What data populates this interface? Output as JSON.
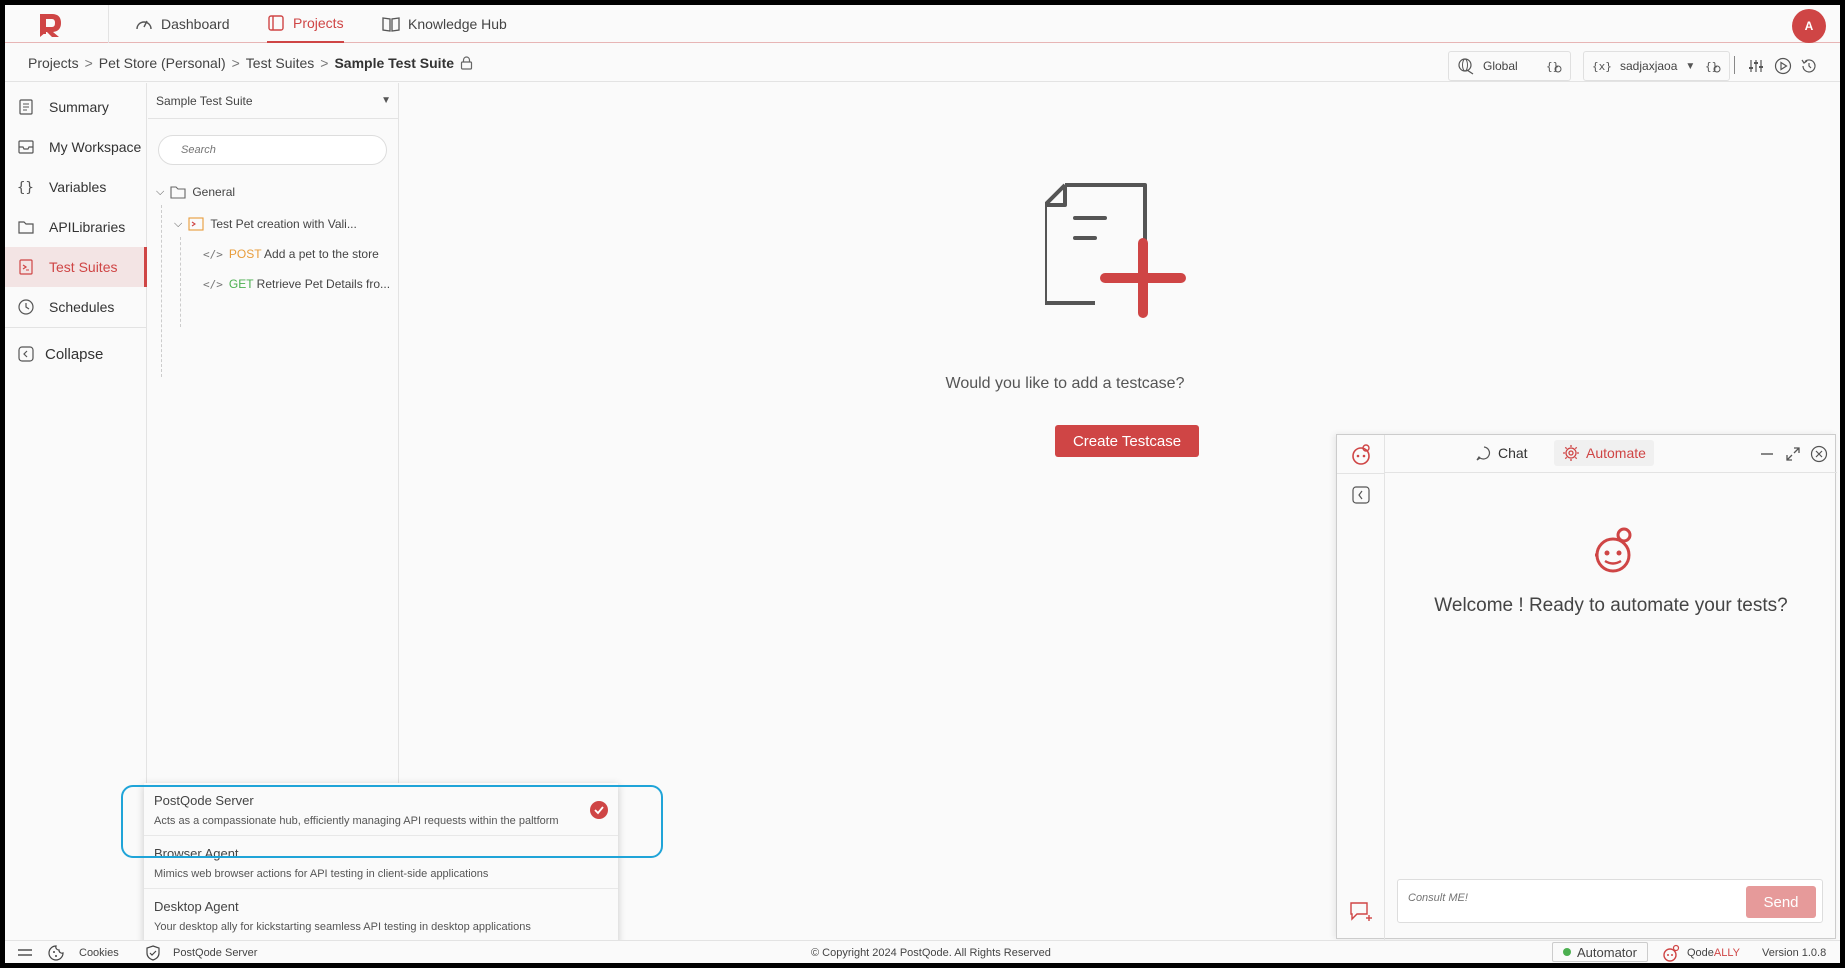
{
  "nav": {
    "items": [
      {
        "label": "Dashboard",
        "icon": "gauge-icon"
      },
      {
        "label": "Projects",
        "icon": "folder-icon"
      },
      {
        "label": "Knowledge Hub",
        "icon": "book-icon"
      }
    ],
    "avatar_initial": "A"
  },
  "breadcrumb": {
    "items": [
      "Projects",
      "Pet Store (Personal)",
      "Test Suites"
    ],
    "current": "Sample Test Suite",
    "separator": ">"
  },
  "env": {
    "global_label": "Global",
    "user_label": "sadjaxjaoa"
  },
  "sidebar": {
    "items": [
      {
        "label": "Summary",
        "icon": "summary-icon"
      },
      {
        "label": "My Workspace",
        "icon": "inbox-icon"
      },
      {
        "label": "Variables",
        "icon": "braces-icon"
      },
      {
        "label": "APILibraries",
        "icon": "folder-icon"
      },
      {
        "label": "Test Suites",
        "icon": "test-suite-icon"
      },
      {
        "label": "Schedules",
        "icon": "clock-icon"
      }
    ],
    "collapse_label": "Collapse"
  },
  "tree": {
    "suite_name": "Sample Test Suite",
    "search_placeholder": "Search",
    "folder": "General",
    "testcase": "Test Pet creation with Vali...",
    "requests": [
      {
        "method": "POST",
        "name": "Add a pet to the store"
      },
      {
        "method": "GET",
        "name": "Retrieve Pet Details fro..."
      }
    ]
  },
  "main": {
    "prompt": "Would you like to add a testcase?",
    "create_button": "Create Testcase"
  },
  "chat": {
    "tabs": [
      "Chat",
      "Automate"
    ],
    "welcome": "Welcome ! Ready to automate your tests?",
    "input_placeholder": "Consult ME!",
    "send_label": "Send"
  },
  "agents": [
    {
      "title": "PostQode Server",
      "desc": "Acts as a compassionate hub, efficiently managing API requests within the paltform",
      "selected": true
    },
    {
      "title": "Browser Agent",
      "desc": "Mimics web browser actions for API testing in client-side applications",
      "selected": false
    },
    {
      "title": "Desktop Agent",
      "desc": "Your desktop ally for kickstarting seamless API testing in desktop applications",
      "selected": false
    }
  ],
  "footer": {
    "cookies": "Cookies",
    "server": "PostQode Server",
    "copyright": "© Copyright 2024 PostQode. All Rights Reserved",
    "automator": "Automator",
    "qodeally_prefix": "Qode",
    "qodeally_suffix": "ALLY",
    "version": "Version 1.0.8"
  },
  "colors": {
    "accent": "#cf4545",
    "highlight": "#1fa4d8",
    "post": "#e89c3a",
    "get": "#4caf50"
  }
}
